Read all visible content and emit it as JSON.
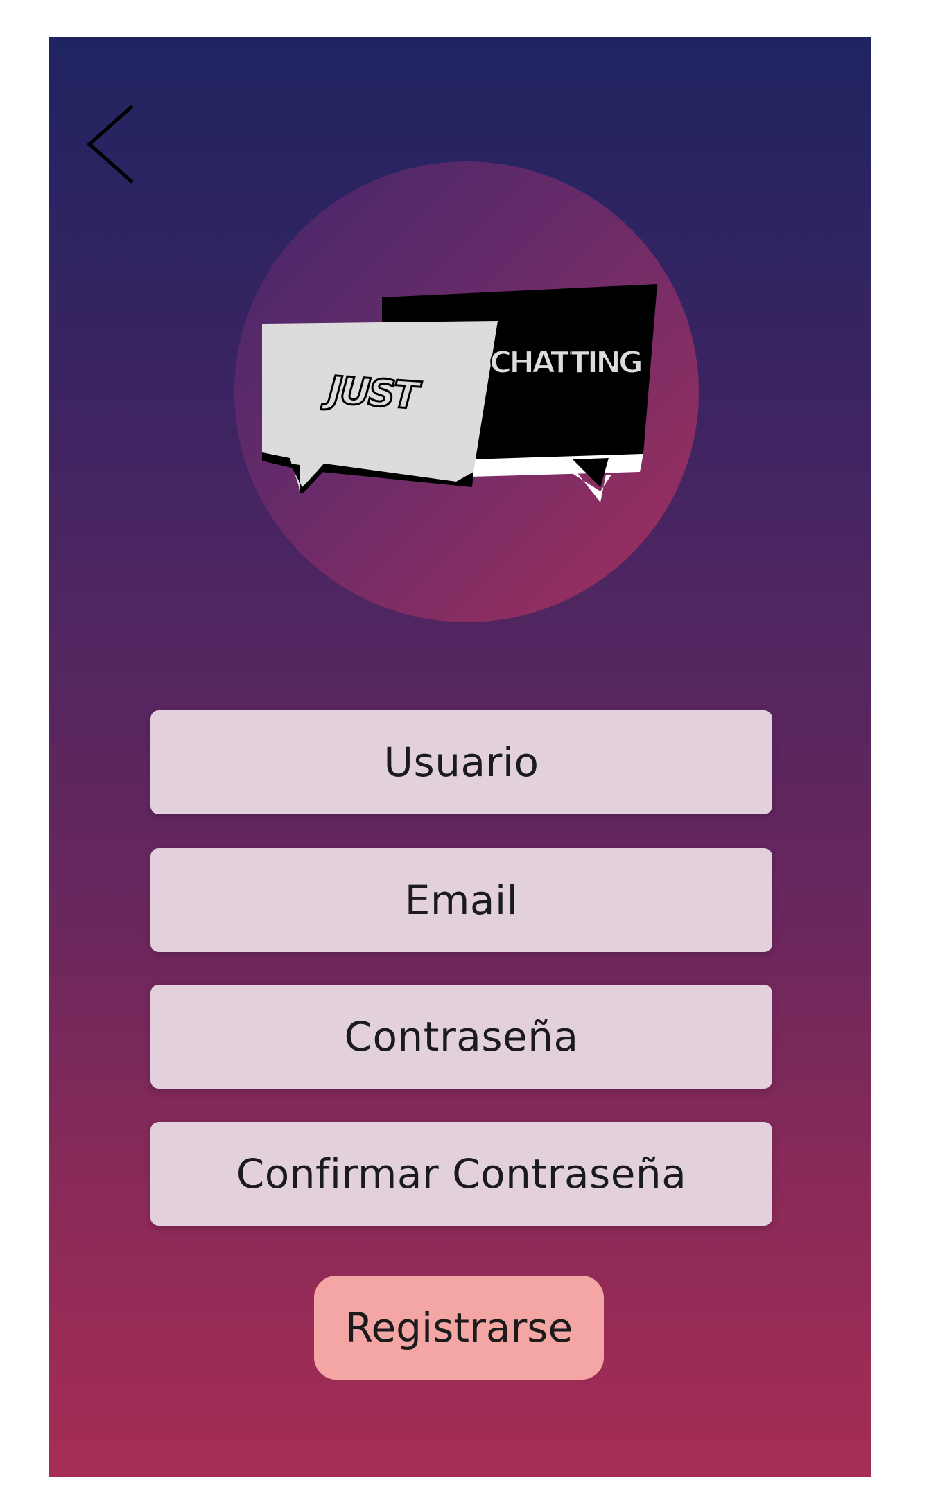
{
  "navigation": {
    "back_icon": "chevron-left-icon"
  },
  "logo": {
    "word_left": "JUST",
    "word_right": "CHATTING",
    "colors": {
      "circle_start": "#44276a",
      "circle_end": "#a2305d",
      "bubble_light": "#dcdcdc",
      "bubble_dark": "#000000"
    }
  },
  "form": {
    "username_placeholder": "Usuario",
    "email_placeholder": "Email",
    "password_placeholder": "Contraseña",
    "confirm_password_placeholder": "Confirmar Contraseña",
    "submit_label": "Registrarse"
  },
  "colors": {
    "background_top": "#1f2461",
    "background_bottom": "#a52d55",
    "field_background": "#e2d0dc",
    "button_background": "#f4a6a5"
  }
}
